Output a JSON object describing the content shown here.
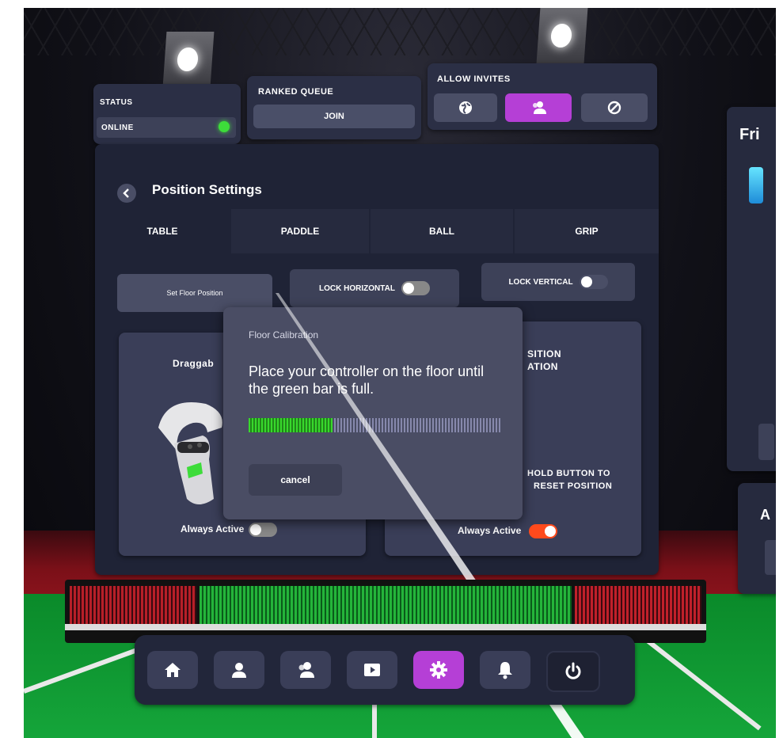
{
  "status": {
    "label": "STATUS",
    "value": "ONLINE",
    "indicator_color": "#3ddc3a"
  },
  "ranked": {
    "label": "RANKED QUEUE",
    "join_label": "JOIN"
  },
  "invites": {
    "label": "ALLOW INVITES",
    "options": [
      "globe-icon",
      "friends-icon",
      "blocked-icon"
    ],
    "active_option": "friends-icon",
    "accent": "#b53fd6"
  },
  "settings": {
    "title": "Position Settings",
    "tabs": [
      "TABLE",
      "PADDLE",
      "BALL",
      "GRIP"
    ],
    "active_tab": "TABLE",
    "set_floor_label": "Set Floor Position",
    "lock_horizontal_label": "LOCK HORIZONTAL",
    "lock_vertical_label": "LOCK VERTICAL",
    "card_left_title": "Draggab",
    "card_left_always": "Always Active",
    "card_right_title_1": "SITION",
    "card_right_title_2": "ATION",
    "card_right_hold_1": "HOLD BUTTON TO",
    "card_right_hold_2": "RESET POSITION",
    "card_right_always": "Always Active"
  },
  "dialog": {
    "title": "Floor Calibration",
    "message": "Place your controller on the floor until the green bar is full.",
    "progress": 0.33,
    "cancel_label": "cancel"
  },
  "side": {
    "title_fragment": "Fri",
    "title_fragment_2": "A"
  },
  "nav": {
    "items": [
      "home-icon",
      "profile-icon",
      "friends-icon",
      "video-icon",
      "gear-icon",
      "bell-icon",
      "power-icon"
    ],
    "active": "gear-icon"
  },
  "colors": {
    "accent": "#b53fd6",
    "toggle_on": "#ff4a1c",
    "progress": "#38e02a"
  }
}
